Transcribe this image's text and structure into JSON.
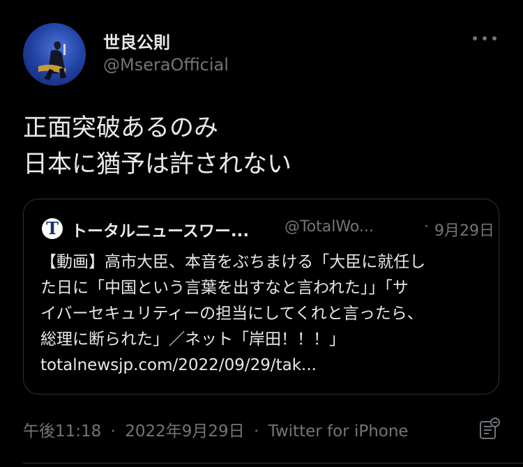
{
  "author": {
    "display_name": "世良公則",
    "handle": "@MseraOfficial"
  },
  "tweet": {
    "lines": [
      "正面突破あるのみ",
      "日本に猶予は許されない"
    ]
  },
  "quoted": {
    "avatar_letter": "T",
    "name": "トータルニュースワー...",
    "handle": "@TotalWo...",
    "dot": "·",
    "date": "9月29日",
    "lines": [
      "【動画】高市大臣、本音をぶちまける「大臣に就任し",
      "た日に「中国という言葉を出すなと言われた」」「サ",
      "イバーセキュリティーの担当にしてくれと言ったら、",
      "総理に断られた」／ネット「岸田！！！」",
      "totalnewsjp.com/2022/09/29/tak..."
    ]
  },
  "meta": {
    "time": "午後11:18",
    "sep": "·",
    "date": "2022年9月29日",
    "source": "Twitter for iPhone"
  },
  "icons": {
    "more": "more-icon",
    "notes": "notes-icon"
  },
  "colors": {
    "background": "#000000",
    "text": "#e7e9ea",
    "secondary": "#71767b",
    "border": "#2f3336"
  }
}
